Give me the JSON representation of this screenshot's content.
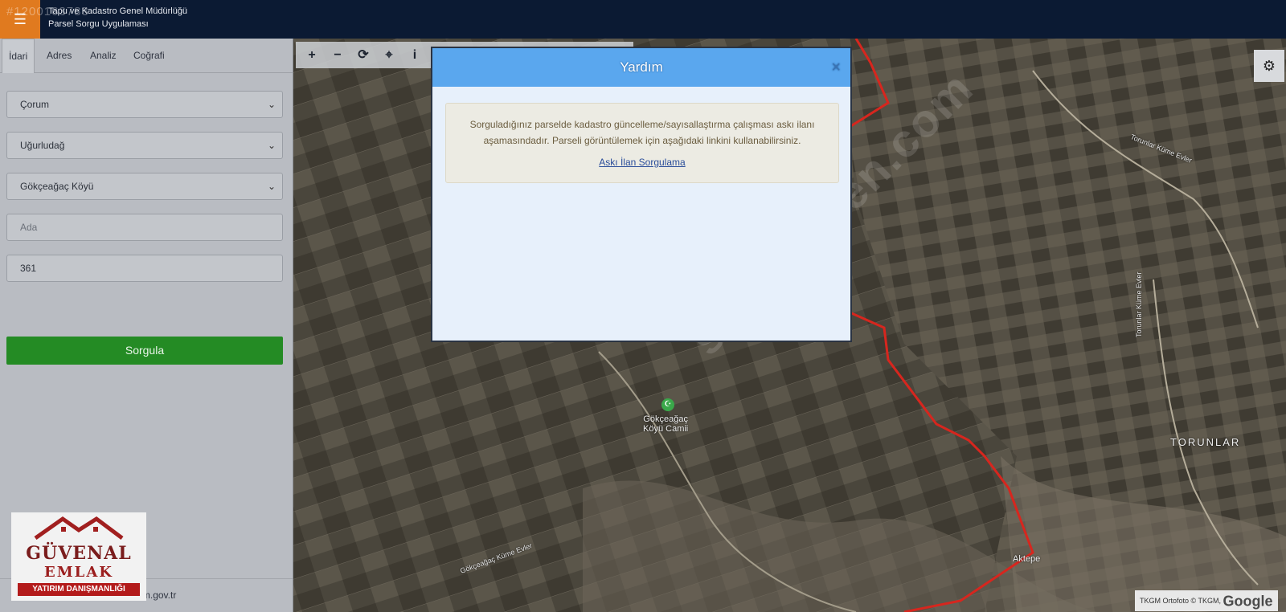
{
  "header": {
    "listing_id": "#1200163783",
    "title": "Tapu ve Kadastro Genel Müdürlüğü",
    "subtitle": "Parsel Sorgu Uygulaması",
    "menu_icon": "hamburger-icon"
  },
  "sidebar": {
    "tabs": [
      {
        "label": "İdari",
        "active": true
      },
      {
        "label": "Adres"
      },
      {
        "label": "Analiz"
      },
      {
        "label": "Coğrafi"
      }
    ],
    "province": "Çorum",
    "district": "Uğurludağ",
    "neighborhood": "Gökçeağaç Köyü",
    "ada_placeholder": "Ada",
    "parsel_value": "361",
    "query_button": "Sorgula",
    "footer_email": "cbs@tkgm.gov.tr"
  },
  "logo": {
    "brand_line1": "GÜVENAL",
    "brand_line2": "EMLAK",
    "tagline": "YATIRIM DANIŞMANLIĞI"
  },
  "map": {
    "toolbar": [
      "zoom-in",
      "zoom-out",
      "refresh",
      "locate",
      "info"
    ],
    "labels": {
      "mosque": "Gökçeağaç\nKöyü Camii",
      "village": "TORUNLAR",
      "hill": "Aktepe",
      "road1": "Torunlar Küme Evler",
      "road2": "Gökçeağaç Küme Evler",
      "watermark": "sahibinden.com"
    },
    "attribution_text": "TKGM Ortofoto © TKGM,",
    "attribution_brand": "Google",
    "boundary_color": "#d7261e"
  },
  "modal": {
    "title": "Yardım",
    "message": "Sorguladığınız parselde kadastro güncelleme/sayısallaştırma çalışması askı ilanı aşamasındadır. Parseli görüntülemek için aşağıdaki linkini kullanabilirsiniz.",
    "link": "Askı İlan Sorgulama",
    "close_icon": "close-icon"
  }
}
